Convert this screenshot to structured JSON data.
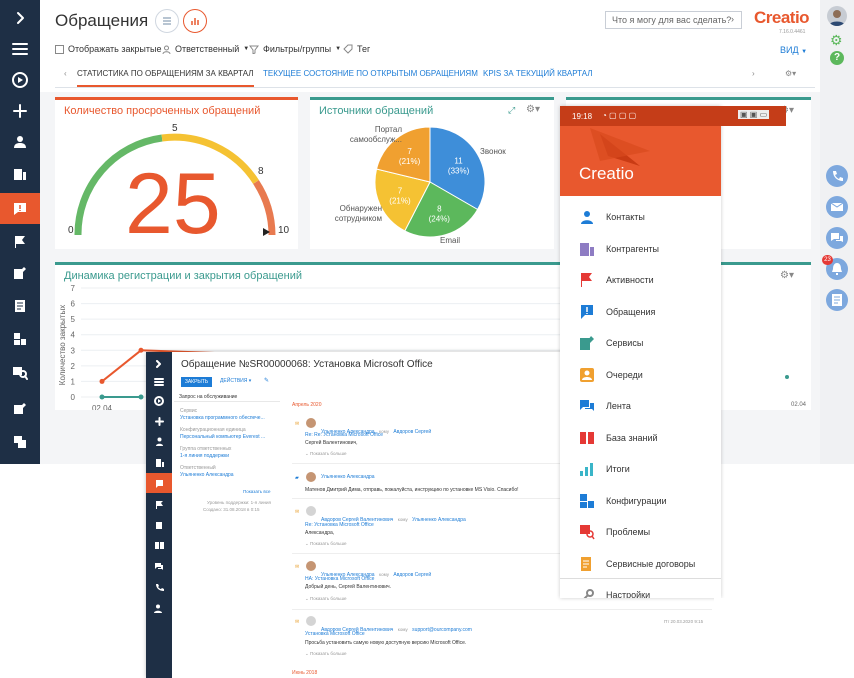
{
  "header": {
    "title": "Обращения",
    "search_placeholder": "Что я могу для вас сделать?",
    "logo": "Creatio",
    "version": "7.16.0.4461",
    "view_label": "ВИД"
  },
  "toolbar": {
    "show_closed": "Отображать закрытые",
    "responsible": "Ответственный",
    "filters": "Фильтры/группы",
    "tag": "Тег"
  },
  "tabs": [
    "СТАТИСТИКА ПО ОБРАЩЕНИЯМ ЗА КВАРТАЛ",
    "ТЕКУЩЕЕ СОСТОЯНИЕ ПО ОТКРЫТЫМ ОБРАЩЕНИЯМ",
    "KPIS ЗА ТЕКУЩИЙ КВАРТАЛ"
  ],
  "gauge": {
    "title": "Количество просроченных обращений",
    "value": "25",
    "labels": [
      "0",
      "5",
      "8",
      "10"
    ]
  },
  "sources": {
    "title": "Источники обращений"
  },
  "dynamics": {
    "title": "Динамика регистрации и закрытия обращений"
  },
  "chart_data": [
    {
      "type": "pie",
      "title": "Источники обращений",
      "slices": [
        {
          "label": "Звонок",
          "value": 11,
          "pct": "(33%)",
          "color": "#3e8ed9"
        },
        {
          "label": "Email",
          "value": 8,
          "pct": "(24%)",
          "color": "#5cb85c"
        },
        {
          "label": "Обнаружен сотрудником",
          "value": 7,
          "pct": "(21%)",
          "color": "#f5c233"
        },
        {
          "label": "Портал самообслуж...",
          "value": 7,
          "pct": "(21%)",
          "color": "#f0a030"
        }
      ]
    },
    {
      "type": "line",
      "title": "Динамика регистрации и закрытия обращений",
      "ylabel": "Количество закрытых",
      "ylim": [
        0,
        7
      ],
      "yticks": [
        "0",
        "1",
        "2",
        "3",
        "4",
        "5",
        "6",
        "7"
      ],
      "x_labels": [
        "02.04",
        "02.04"
      ],
      "series": [
        {
          "color": "#e8582e",
          "points": [
            [
              0,
              1
            ],
            [
              1,
              3
            ],
            [
              2,
              2
            ]
          ]
        },
        {
          "color": "#3a9a8e",
          "points": [
            [
              0,
              0
            ],
            [
              1,
              0
            ]
          ]
        }
      ]
    }
  ],
  "case": {
    "title": "Обращение №SR00000068: Установка Microsoft Office",
    "close_btn": "ЗАКРЫТЬ",
    "actions": "ДЕЙСТВИЯ",
    "section": "Запрос на обслуживание",
    "fields": [
      {
        "label": "Сервис",
        "value": "Установка программного обеспече..."
      },
      {
        "label": "Конфигурационная единица",
        "value": "Персональный компьютер Everest ..."
      },
      {
        "label": "Группа ответственных",
        "value": "1-я линия поддержки"
      },
      {
        "label": "Ответственный",
        "value": "Ульяненко Александра"
      }
    ],
    "show_more": "Показать все",
    "support_level": "Уровень поддержки: 1-я линия",
    "created": "Создано: 31.08.2018 в 0:15",
    "month1": "Апрель 2020",
    "month2": "Июнь 2018",
    "feed": [
      {
        "from": "Ульяненко Александра",
        "to": "Авдоров Сергей",
        "subj": "Re: Re: Установка Microsoft Office",
        "body": "Сергей Валентинович,",
        "more": "Показать больше"
      },
      {
        "from": "Ульяненко Александра",
        "to": "",
        "subj": "",
        "body": "Матенов Дмитрий Дима, отправь, пожалуйста, инструкцию по установке MS Visio. Спасибо!",
        "more": ""
      },
      {
        "from": "Авдоров Сергей Валентинович",
        "to": "Ульяненко Александра",
        "subj": "Re: Установка Microsoft Office",
        "body": "Александра,",
        "more": "Показать больше"
      },
      {
        "from": "Ульяненко Александра",
        "to": "Авдоров Сергей",
        "subj": "НА: Установка Microsoft Office",
        "body": "Добрый день, Сергей Валентинович.",
        "more": "Показать больше"
      },
      {
        "from": "Авдоров Сергей Валентинович",
        "to": "support@ourcompany.com",
        "subj": "Установка Microsoft Office",
        "body": "Просьба установить самую новую доступную версию Microsoft Office.",
        "more": "Показать больше",
        "date": "Пт 20.03.2020 9:15"
      }
    ],
    "to_word": "кому"
  },
  "phone": {
    "time": "19:18",
    "logo": "Creatio",
    "menu": [
      "Контакты",
      "Контрагенты",
      "Активности",
      "Обращения",
      "Сервисы",
      "Очереди",
      "Лента",
      "База знаний",
      "Итоги",
      "Конфигурации",
      "Проблемы",
      "Сервисные договоры",
      "Настройки"
    ]
  },
  "right": {
    "badge": "23"
  }
}
